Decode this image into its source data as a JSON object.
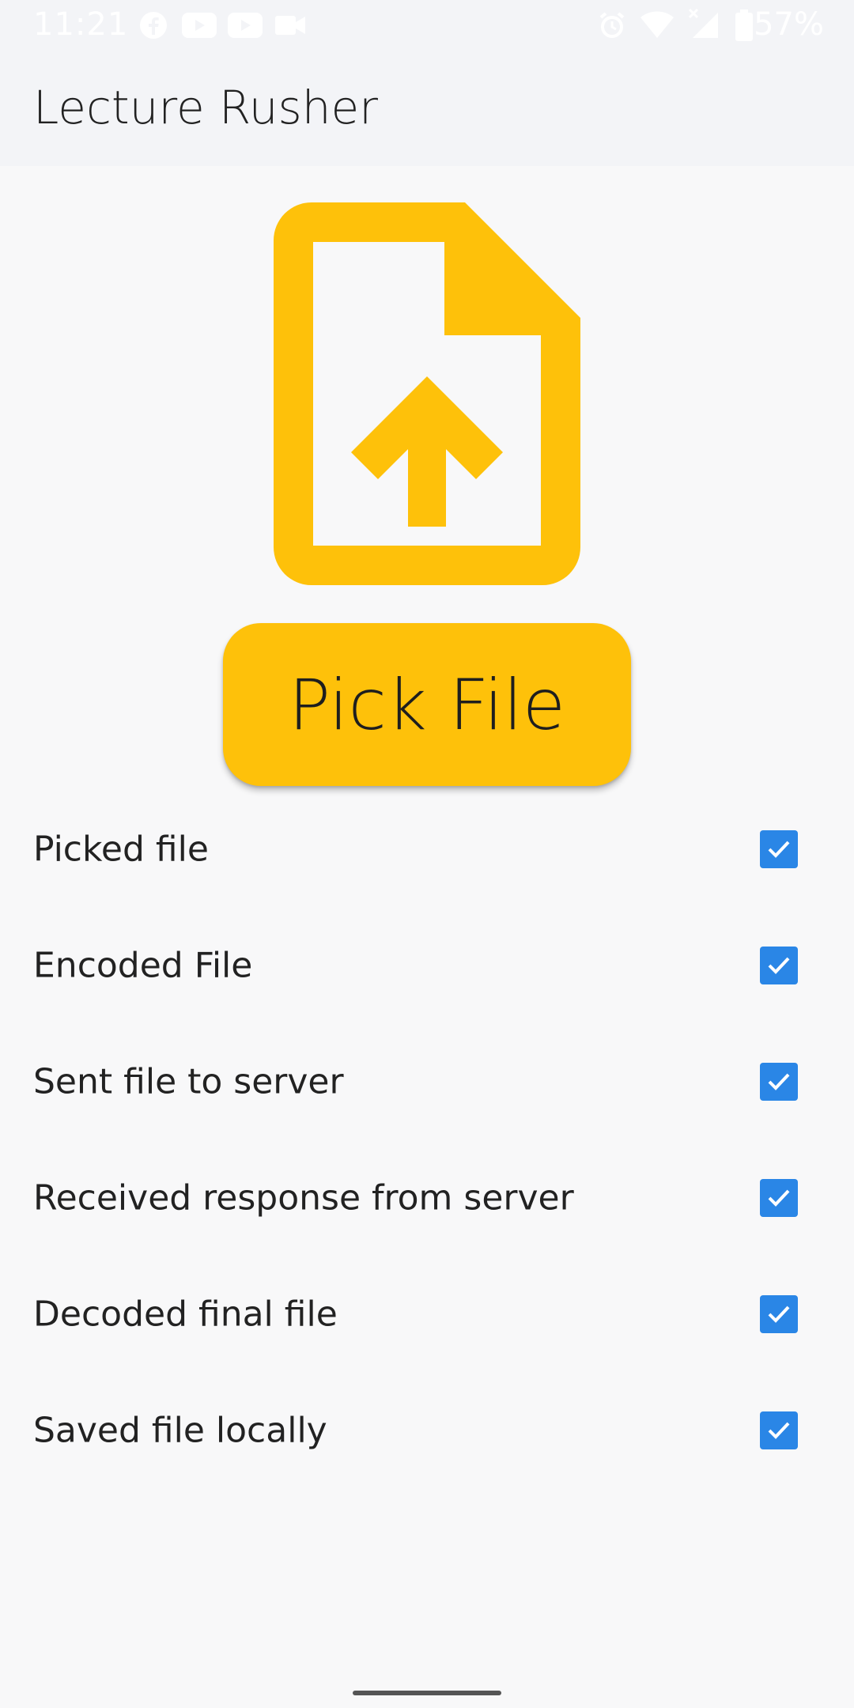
{
  "status_bar": {
    "time": "11:21",
    "battery_percent": "57%",
    "icons_left": [
      "facebook-icon",
      "youtube-icon",
      "youtube-icon",
      "video-camera-icon"
    ],
    "icons_right": [
      "alarm-icon",
      "wifi-icon",
      "signal-icon",
      "battery-icon"
    ]
  },
  "app_bar": {
    "title": "Lecture Rusher"
  },
  "main": {
    "icon": "upload-file-icon",
    "pick_button_label": "Pick File",
    "steps": [
      {
        "label": "Picked file",
        "checked": true
      },
      {
        "label": "Encoded File",
        "checked": true
      },
      {
        "label": "Sent file to server",
        "checked": true
      },
      {
        "label": "Received response from server",
        "checked": true
      },
      {
        "label": "Decoded final file",
        "checked": true
      },
      {
        "label": "Saved file locally",
        "checked": true
      }
    ]
  },
  "colors": {
    "accent": "#fec10a",
    "checkbox": "#2a86e6",
    "app_bar_bg": "#f3f4f7",
    "background": "#f8f8f9"
  }
}
